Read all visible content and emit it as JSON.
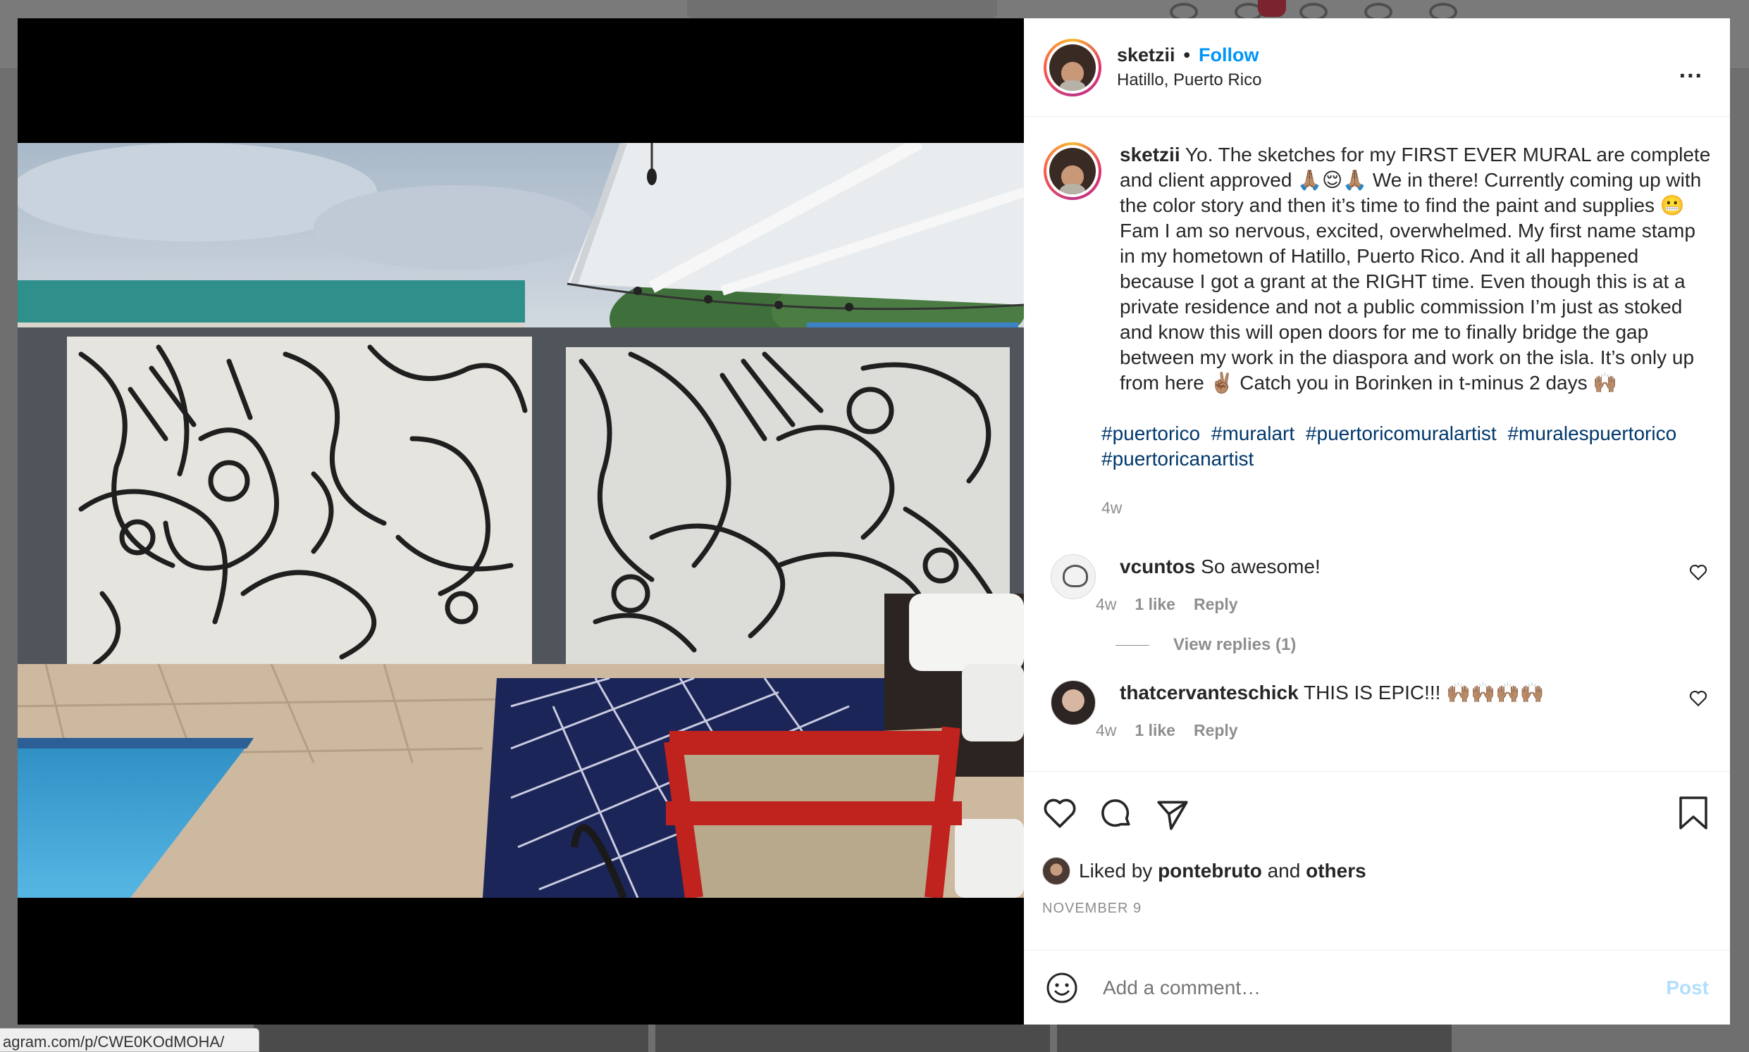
{
  "browser": {
    "status_url": "agram.com/p/CWE0KOdMOHA/"
  },
  "post": {
    "author": {
      "username": "sketzii",
      "follow_label": "Follow",
      "location": "Hatillo, Puerto Rico"
    },
    "more_options_label": "...",
    "caption": {
      "username": "sketzii",
      "text": "Yo. The sketches for my FIRST EVER MURAL are complete and client approved 🙏🏽😌🙏🏽 We in there! Currently coming up with the color story and then it’s time to find the paint and supplies 😬 Fam I am so nervous, excited, overwhelmed. My first name stamp in my hometown of Hatillo, Puerto Rico. And it all happened because I got a grant at the RIGHT time. Even though this is at a private residence and not a public commission I’m just as stoked and know this will open doors for me to finally bridge the gap between my work in the diaspora and work on the isla. It’s only up from here ✌🏽 Catch you in Borinken in t-minus 2 days 🙌🏽",
      "hashtags": [
        "#puertorico",
        "#muralart",
        "#puertoricomuralartist",
        "#muralespuertorico",
        "#puertoricanartist"
      ],
      "time": "4w"
    },
    "comments": [
      {
        "username": "vcuntos",
        "text": "So awesome!",
        "time": "4w",
        "likes": "1 like",
        "reply_label": "Reply",
        "view_replies": "View replies (1)"
      },
      {
        "username": "thatcervanteschick",
        "text": "THIS IS EPIC!!! 🙌🏽🙌🏽🙌🏽🙌🏽",
        "time": "4w",
        "likes": "1 like",
        "reply_label": "Reply"
      }
    ],
    "liked_by": {
      "prefix": "Liked by",
      "user": "pontebruto",
      "and": "and",
      "others": "others"
    },
    "date": "NOVEMBER 9",
    "add_comment": {
      "placeholder": "Add a comment…",
      "post_label": "Post"
    }
  },
  "colors": {
    "follow": "#0095f6",
    "hashtag": "#00376b",
    "post_disabled": "#b2dffc",
    "muted": "#8e8e8e"
  }
}
